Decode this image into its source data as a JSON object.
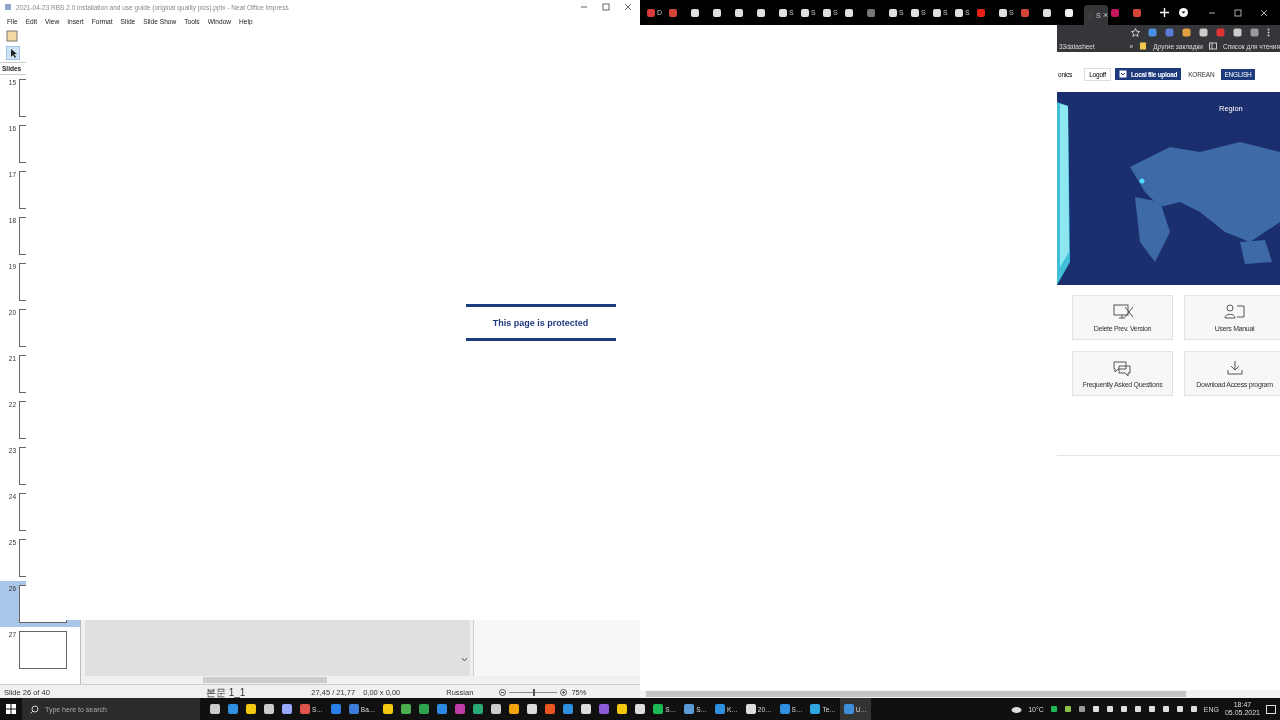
{
  "impress": {
    "title": "2021-04-23 RBS 2.0 installation and use guide (original quality pics).pptx - Neat Office Impress",
    "menu": [
      "File",
      "Edit",
      "View",
      "Insert",
      "Format",
      "Slide",
      "Slide Show",
      "Tools",
      "Window",
      "Help"
    ],
    "slides_label": "Slides",
    "slides": [
      {
        "number": "15",
        "selected": false
      },
      {
        "number": "16",
        "selected": false
      },
      {
        "number": "17",
        "selected": false
      },
      {
        "number": "18",
        "selected": false
      },
      {
        "number": "19",
        "selected": false
      },
      {
        "number": "20",
        "selected": false
      },
      {
        "number": "21",
        "selected": false
      },
      {
        "number": "22",
        "selected": false
      },
      {
        "number": "23",
        "selected": false
      },
      {
        "number": "24",
        "selected": false
      },
      {
        "number": "25",
        "selected": false
      },
      {
        "number": "26",
        "selected": true
      },
      {
        "number": "27",
        "selected": false
      }
    ],
    "status_bar": {
      "slide": "Slide 26 of 40",
      "layout": "본문 1_1",
      "position": "27,45 / 21,77",
      "size": "0,00 x 0,00",
      "language": "Russian",
      "zoom_slider": {
        "level": 0.5
      },
      "zoom": "75%"
    }
  },
  "browser": {
    "tabs": [
      {
        "color": "#d83a3a",
        "title": "D",
        "selected": false
      },
      {
        "color": "#d44638",
        "selected": false
      },
      {
        "color": "#e0e0e0",
        "selected": false
      },
      {
        "color": "#e0e0e0",
        "selected": false
      },
      {
        "color": "#e0e0e0",
        "selected": false
      },
      {
        "color": "#e0e0e0",
        "selected": false
      },
      {
        "color": "#e0e0e0",
        "title": "S",
        "selected": false
      },
      {
        "color": "#e0e0e0",
        "title": "S",
        "selected": false
      },
      {
        "color": "#e0e0e0",
        "title": "S",
        "selected": false
      },
      {
        "color": "#e0e0e0",
        "selected": false
      },
      {
        "color": "#777777",
        "selected": false
      },
      {
        "color": "#e0e0e0",
        "title": "S",
        "selected": false
      },
      {
        "color": "#e0e0e0",
        "title": "S",
        "selected": false
      },
      {
        "color": "#e0e0e0",
        "title": "S",
        "selected": false
      },
      {
        "color": "#e0e0e0",
        "title": "S",
        "selected": false
      },
      {
        "color": "#e62117",
        "selected": false
      },
      {
        "color": "#e0e0e0",
        "title": "S",
        "selected": false
      },
      {
        "color": "#d44638",
        "selected": false
      },
      {
        "color": "#e0e0e0",
        "selected": false
      },
      {
        "color": "#f0f0f0",
        "selected": false
      },
      {
        "color": "#3c3c3c",
        "title": "S",
        "selected": true
      },
      {
        "color": "#c2185b",
        "selected": false
      },
      {
        "color": "#d44638",
        "selected": false
      }
    ],
    "bookmarks": [
      "33datasheet",
      "»",
      "Другие закладки",
      "Список для чтения"
    ],
    "page": {
      "header_fragment": "onics",
      "logoff": "Logoff",
      "upload": "Local file upload",
      "languages": [
        {
          "label": "KOREAN",
          "selected": false
        },
        {
          "label": "ENGLISH",
          "selected": true
        }
      ],
      "region": "Region",
      "tiles": [
        {
          "kind": "monitor",
          "label": "Delete Prev. Version"
        },
        {
          "kind": "manual",
          "label": "Users Manual"
        },
        {
          "kind": "chat",
          "label": "Frequently Asked Questions"
        },
        {
          "kind": "download",
          "label": "Download Access program"
        }
      ]
    }
  },
  "overlay": {
    "message": "This page is protected"
  },
  "taskbar": {
    "search_placeholder": "Type here to search",
    "apps": [
      {
        "color": "#cccccc",
        "selected": false
      },
      {
        "color": "#2f8fe0",
        "selected": false
      },
      {
        "color": "#f2c811",
        "selected": false
      },
      {
        "color": "#cccccc",
        "selected": false
      },
      {
        "color": "#9aa7ff",
        "selected": false
      },
      {
        "color": "#e0544c",
        "label": "S…",
        "selected": false
      },
      {
        "color": "#2b7de9",
        "selected": false
      },
      {
        "color": "#3b7dd8",
        "label": "Ba…",
        "selected": false
      },
      {
        "color": "#f2c811",
        "selected": false
      },
      {
        "color": "#4caf50",
        "selected": false
      },
      {
        "color": "#30a14e",
        "selected": false
      },
      {
        "color": "#2b8be0",
        "selected": false
      },
      {
        "color": "#c03ca6",
        "selected": false
      },
      {
        "color": "#2aa876",
        "selected": false
      },
      {
        "color": "#cccccc",
        "selected": false
      },
      {
        "color": "#f4a30f",
        "selected": false
      },
      {
        "color": "#dddddd",
        "selected": false
      },
      {
        "color": "#e95420",
        "selected": false
      },
      {
        "color": "#2f8fe0",
        "selected": false
      },
      {
        "color": "#dddddd",
        "selected": false
      },
      {
        "color": "#8b5ad6",
        "selected": false
      },
      {
        "color": "#f2c811",
        "selected": false
      },
      {
        "color": "#dddddd",
        "selected": false
      },
      {
        "color": "#1db954",
        "label": "S…",
        "selected": false
      },
      {
        "color": "#5b9bd5",
        "label": "S…",
        "selected": false
      },
      {
        "color": "#2f8fe0",
        "label": "K…",
        "selected": false
      },
      {
        "color": "#dddddd",
        "label": "20…",
        "selected": false
      },
      {
        "color": "#2f8fe0",
        "label": "S…",
        "selected": false
      },
      {
        "color": "#2ca5e0",
        "label": "Te…",
        "selected": false
      },
      {
        "color": "#3c8fd8",
        "label": "U…",
        "selected": true
      }
    ],
    "weather": "10°C",
    "lang": "ENG",
    "time": "18:47",
    "date": "05.05.2021"
  }
}
